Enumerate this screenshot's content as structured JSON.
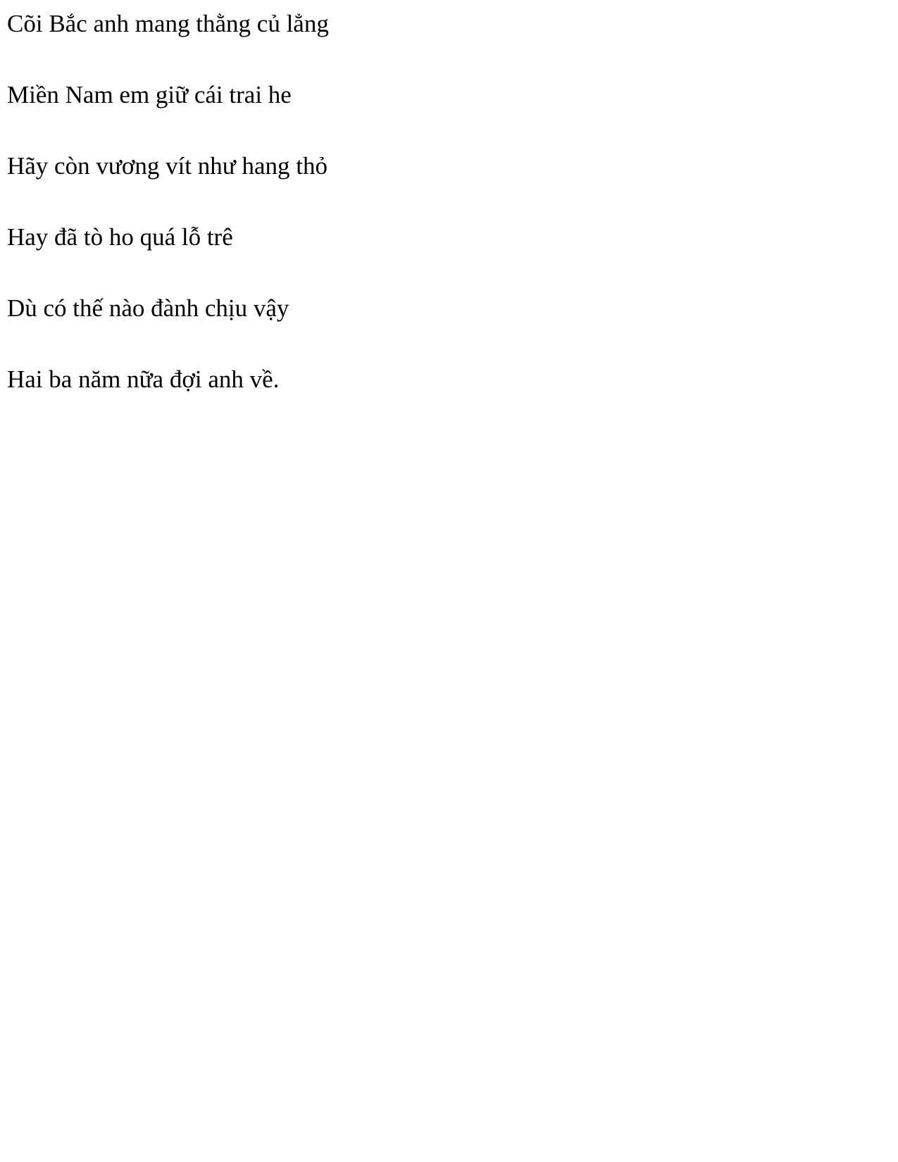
{
  "document": {
    "lines": [
      "Cõi Bắc anh mang thằng củ lẳng",
      "Miền Nam em giữ cái trai he",
      "Hãy còn vương vít như hang thỏ",
      "Hay đã tò ho quá lỗ trê",
      "Dù có thế nào đành chịu vậy",
      "Hai ba năm nữa đợi anh về."
    ]
  }
}
